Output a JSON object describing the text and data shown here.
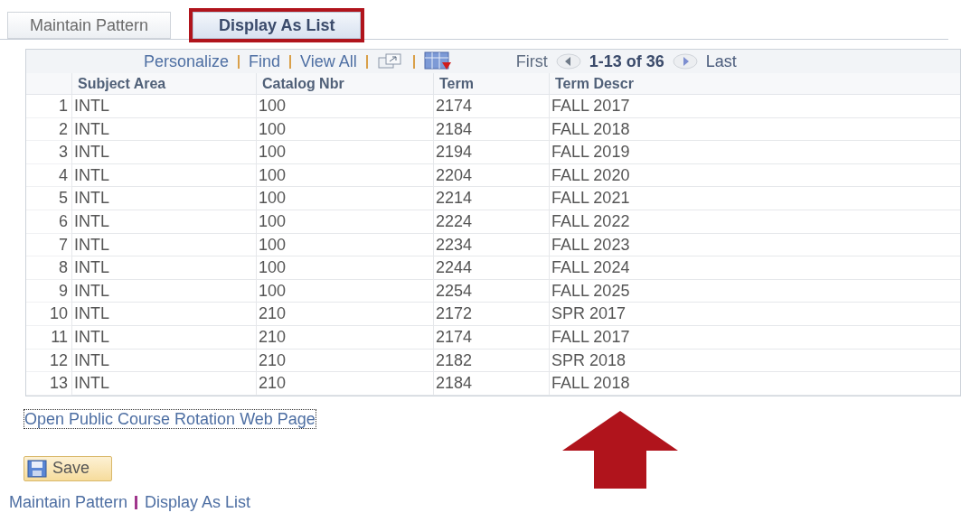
{
  "tabs": [
    {
      "label": "Maintain Pattern",
      "selected": false,
      "highlighted": false
    },
    {
      "label": "Display As List",
      "selected": true,
      "highlighted": true
    }
  ],
  "grid": {
    "toolbar_links": [
      "Personalize",
      "Find",
      "View All"
    ],
    "nav": {
      "first": "First",
      "range": "1-13 of 36",
      "last": "Last"
    },
    "columns": [
      "Subject Area",
      "Catalog Nbr",
      "Term",
      "Term Descr"
    ],
    "rows": [
      {
        "num": "1",
        "cells": [
          "INTL",
          "100",
          "2174",
          "FALL 2017"
        ]
      },
      {
        "num": "2",
        "cells": [
          "INTL",
          "100",
          "2184",
          "FALL 2018"
        ]
      },
      {
        "num": "3",
        "cells": [
          "INTL",
          "100",
          "2194",
          "FALL 2019"
        ]
      },
      {
        "num": "4",
        "cells": [
          "INTL",
          "100",
          "2204",
          "FALL 2020"
        ]
      },
      {
        "num": "5",
        "cells": [
          "INTL",
          "100",
          "2214",
          "FALL 2021"
        ]
      },
      {
        "num": "6",
        "cells": [
          "INTL",
          "100",
          "2224",
          "FALL 2022"
        ]
      },
      {
        "num": "7",
        "cells": [
          "INTL",
          "100",
          "2234",
          "FALL 2023"
        ]
      },
      {
        "num": "8",
        "cells": [
          "INTL",
          "100",
          "2244",
          "FALL 2024"
        ]
      },
      {
        "num": "9",
        "cells": [
          "INTL",
          "100",
          "2254",
          "FALL 2025"
        ]
      },
      {
        "num": "10",
        "cells": [
          "INTL",
          "210",
          "2172",
          "SPR 2017"
        ]
      },
      {
        "num": "11",
        "cells": [
          "INTL",
          "210",
          "2174",
          "FALL 2017"
        ]
      },
      {
        "num": "12",
        "cells": [
          "INTL",
          "210",
          "2182",
          "SPR 2018"
        ]
      },
      {
        "num": "13",
        "cells": [
          "INTL",
          "210",
          "2184",
          "FALL 2018"
        ]
      }
    ]
  },
  "web_link": "Open Public Course Rotation Web Page",
  "save_button": "Save",
  "footer_links": [
    "Maintain Pattern",
    "Display As List"
  ]
}
